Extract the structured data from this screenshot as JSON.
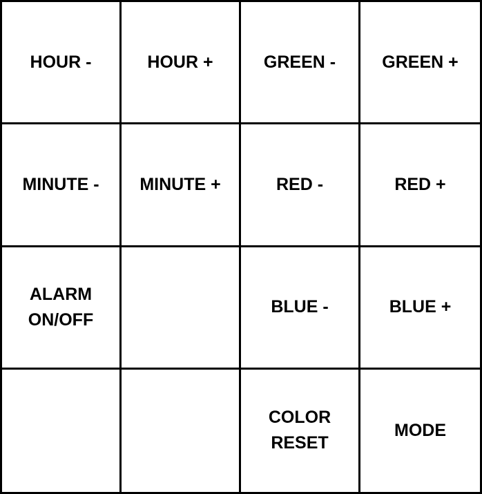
{
  "keypad": {
    "rows": [
      [
        "HOUR -",
        "HOUR +",
        "GREEN -",
        "GREEN +"
      ],
      [
        "MINUTE -",
        "MINUTE +",
        "RED -",
        "RED +"
      ],
      [
        "ALARM\nON/OFF",
        "",
        "BLUE -",
        "BLUE +"
      ],
      [
        "",
        "",
        "COLOR\nRESET",
        "MODE"
      ]
    ]
  }
}
